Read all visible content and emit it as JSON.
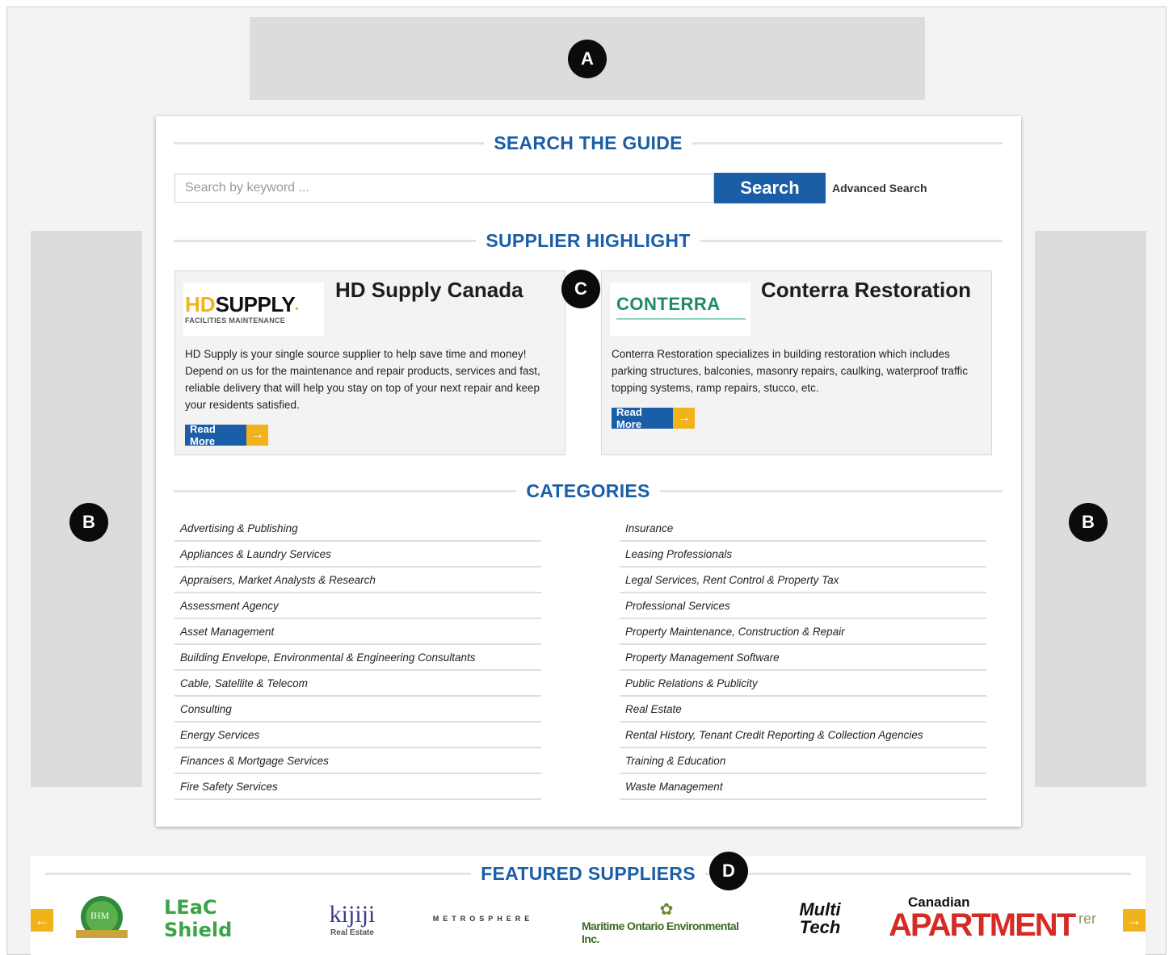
{
  "markers": {
    "a": "A",
    "b": "B",
    "c": "C",
    "d": "D"
  },
  "search": {
    "heading": "SEARCH THE GUIDE",
    "placeholder": "Search by keyword ...",
    "button_label": "Search",
    "advanced_link": "Advanced Search"
  },
  "highlight": {
    "heading": "SUPPLIER HIGHLIGHT",
    "suppliers": [
      {
        "name": "HD Supply Canada",
        "logo_text": "SUPPLY",
        "logo_prefix": "HD",
        "logo_sub": "FACILITIES MAINTENANCE",
        "description": "HD Supply is your single source supplier to help save time and money! Depend on us for the maintenance and repair products, services and fast, reliable delivery that will help you stay on top of your next repair and keep your residents satisfied.",
        "read_more": "Read More"
      },
      {
        "name": "Conterra Restoration",
        "logo_text": "CONTERRA",
        "description": "Conterra Restoration specializes in building restoration which includes parking structures, balconies, masonry repairs, caulking, waterproof traffic topping systems, ramp repairs, stucco, etc.",
        "read_more": "Read More"
      }
    ]
  },
  "categories": {
    "heading": "CATEGORIES",
    "left": [
      "Advertising & Publishing",
      "Appliances & Laundry Services",
      "Appraisers, Market Analysts & Research",
      "Assessment Agency",
      "Asset Management",
      "Building Envelope, Environmental & Engineering Consultants",
      "Cable, Satellite & Telecom",
      "Consulting",
      "Energy Services",
      "Finances & Mortgage Services",
      "Fire Safety Services"
    ],
    "right": [
      "Insurance",
      "Leasing Professionals",
      "Legal Services, Rent Control & Property Tax",
      "Professional Services",
      "Property Maintenance, Construction & Repair",
      "Property Management Software",
      "Public Relations & Publicity",
      "Real Estate",
      "Rental History, Tenant Credit Reporting & Collection Agencies",
      "Training & Education",
      "Waste Management"
    ]
  },
  "featured": {
    "heading": "FEATURED SUPPLIERS",
    "logos": {
      "ihm": "IHM",
      "leakshield": "LEaC Shield",
      "kijiji": "kijiji",
      "kijiji_sub": "Real Estate",
      "metrosphere": "METROSPHERE",
      "maritime": "Maritime Ontario Environmental Inc.",
      "multitech_1": "Multi",
      "multitech_2": "Tech",
      "canadian": "Canadian",
      "apartment": "APARTMENT",
      "partial": "rer"
    },
    "prev_icon": "arrow-left-icon",
    "next_icon": "arrow-right-icon"
  },
  "colors": {
    "brand_blue": "#1a5ea8",
    "accent_yellow": "#f2b21a",
    "placeholder_gray": "#dcdcdc"
  }
}
